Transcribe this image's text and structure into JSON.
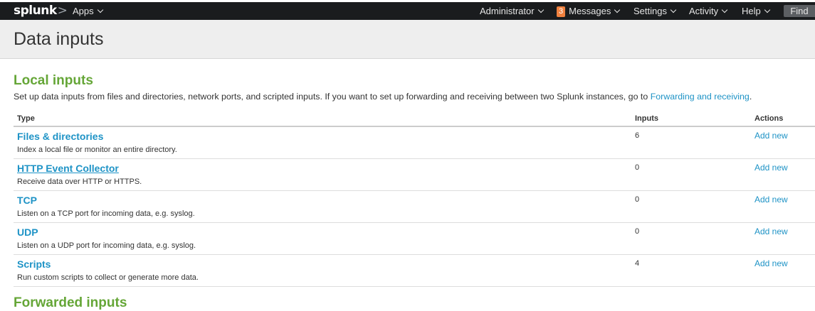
{
  "navbar": {
    "logo": "splunk",
    "logo_suffix": ">",
    "apps_label": "Apps",
    "user_label": "Administrator",
    "messages_count": "3",
    "messages_label": "Messages",
    "settings_label": "Settings",
    "activity_label": "Activity",
    "help_label": "Help",
    "find_label": "Find"
  },
  "page": {
    "title": "Data inputs"
  },
  "local_inputs": {
    "heading": "Local inputs",
    "description": "Set up data inputs from files and directories, network ports, and scripted inputs. If you want to set up forwarding and receiving between two Splunk instances, go to ",
    "description_link": "Forwarding and receiving",
    "description_end": ".",
    "columns": {
      "type": "Type",
      "inputs": "Inputs",
      "actions": "Actions"
    },
    "rows": [
      {
        "name": "Files & directories",
        "description": "Index a local file or monitor an entire directory.",
        "count": "6",
        "action": "Add new"
      },
      {
        "name": "HTTP Event Collector",
        "description": "Receive data over HTTP or HTTPS.",
        "count": "0",
        "action": "Add new"
      },
      {
        "name": "TCP",
        "description": "Listen on a TCP port for incoming data, e.g. syslog.",
        "count": "0",
        "action": "Add new"
      },
      {
        "name": "UDP",
        "description": "Listen on a UDP port for incoming data, e.g. syslog.",
        "count": "0",
        "action": "Add new"
      },
      {
        "name": "Scripts",
        "description": "Run custom scripts to collect or generate more data.",
        "count": "4",
        "action": "Add new"
      }
    ]
  },
  "forwarded_inputs": {
    "heading": "Forwarded inputs"
  },
  "colors": {
    "navbar_bg": "#1a1c1e",
    "section_heading": "#65a637",
    "link": "#1e93c6",
    "badge": "#f1813f"
  }
}
